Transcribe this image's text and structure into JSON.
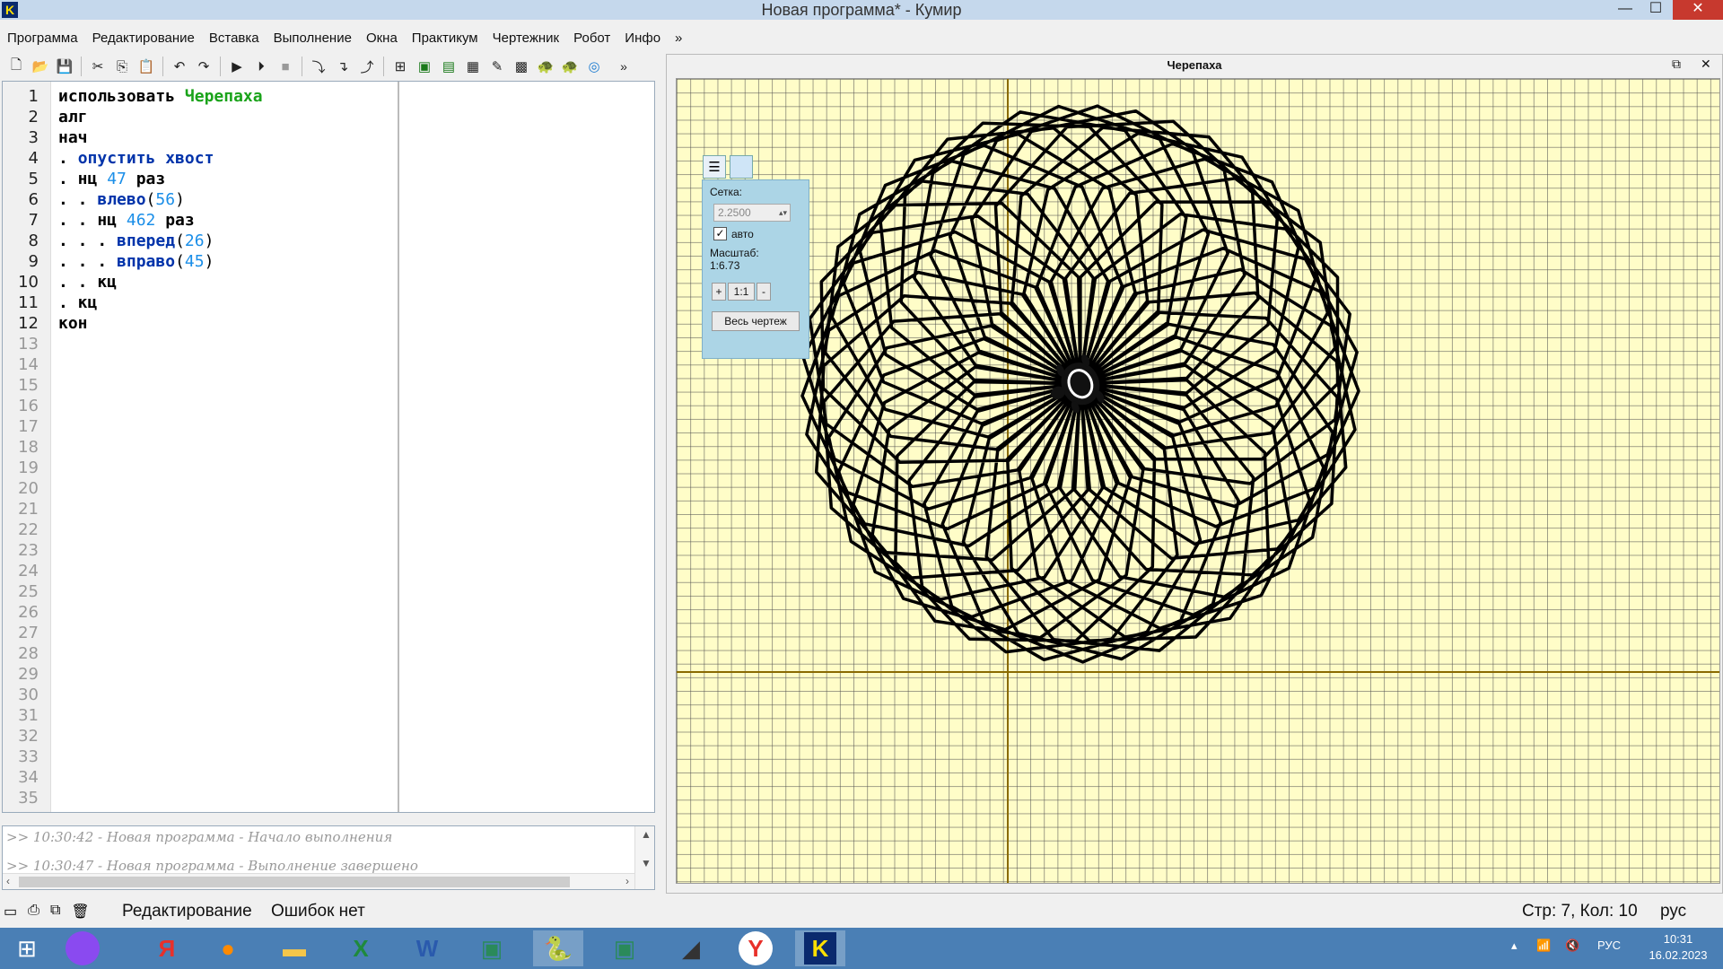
{
  "window": {
    "title": "Новая программа* - Кумир",
    "logo": "K",
    "min": "—",
    "max": "☐",
    "close": "✕"
  },
  "menu": [
    "Программа",
    "Редактирование",
    "Вставка",
    "Выполнение",
    "Окна",
    "Практикум",
    "Чертежник",
    "Робот",
    "Инфо",
    "»"
  ],
  "toolbar": {
    "icons": [
      "new-file",
      "open-folder",
      "save",
      "cut",
      "copy",
      "paste",
      "undo",
      "redo",
      "run",
      "step",
      "stop",
      "step-into",
      "step-over",
      "step-out",
      "variables",
      "robot-panel",
      "drawer-panel",
      "grid",
      "painter",
      "turtle",
      "turtle-alt",
      "water"
    ],
    "more": "»"
  },
  "editor": {
    "lines": [
      [
        {
          "t": "использовать ",
          "c": "kw"
        },
        {
          "t": "Черепаха",
          "c": "grn"
        }
      ],
      [
        {
          "t": "алг",
          "c": "kw"
        }
      ],
      [
        {
          "t": "нач",
          "c": "kw"
        }
      ],
      [
        {
          "t": ". ",
          "c": "kw"
        },
        {
          "t": "опустить хвост",
          "c": "kwb"
        }
      ],
      [
        {
          "t": ". нц ",
          "c": "kw"
        },
        {
          "t": "47",
          "c": "num"
        },
        {
          "t": " раз",
          "c": "kw"
        }
      ],
      [
        {
          "t": ". . ",
          "c": "kw"
        },
        {
          "t": "влево",
          "c": "kwb"
        },
        {
          "t": "(",
          "c": ""
        },
        {
          "t": "56",
          "c": "num"
        },
        {
          "t": ")",
          "c": ""
        }
      ],
      [
        {
          "t": ". . нц ",
          "c": "kw"
        },
        {
          "t": "462",
          "c": "num"
        },
        {
          "t": " раз",
          "c": "kw"
        }
      ],
      [
        {
          "t": ". . . ",
          "c": "kw"
        },
        {
          "t": "вперед",
          "c": "kwb"
        },
        {
          "t": "(",
          "c": ""
        },
        {
          "t": "26",
          "c": "num"
        },
        {
          "t": ")",
          "c": ""
        }
      ],
      [
        {
          "t": ". . . ",
          "c": "kw"
        },
        {
          "t": "вправо",
          "c": "kwb"
        },
        {
          "t": "(",
          "c": ""
        },
        {
          "t": "45",
          "c": "num"
        },
        {
          "t": ")",
          "c": ""
        }
      ],
      [
        {
          "t": ". . кц",
          "c": "kw"
        }
      ],
      [
        {
          "t": ". кц",
          "c": "kw"
        }
      ],
      [
        {
          "t": "кон",
          "c": "kw"
        }
      ]
    ],
    "line_count": 35
  },
  "output": {
    "lines": [
      ">> 10:30:42 - Новая программа - Начало выполнения",
      ">> 10:30:47 - Новая программа - Выполнение завершено"
    ]
  },
  "status": {
    "mode": "Редактирование",
    "errors": "Ошибок нет",
    "position": "Стр: 7, Кол: 10",
    "lang": "рус"
  },
  "turtle": {
    "title": "Черепаха",
    "panel": {
      "grid_label": "Сетка:",
      "grid_value": "2.2500",
      "auto_label": "авто",
      "auto_checked": true,
      "scale_label": "Масштаб:",
      "scale_value": "1:6.73",
      "zoom_in": "+",
      "zoom_reset": "1:1",
      "zoom_out": "-",
      "whole_drawing": "Весь чертеж"
    },
    "program": {
      "outer_repeat": 47,
      "left_angle": 56,
      "inner_repeat": 462,
      "forward": 26,
      "right_angle": 45
    }
  },
  "taskbar": {
    "apps": [
      "windows",
      "alice",
      "yandex-browser",
      "firefox",
      "file-explorer",
      "excel",
      "word",
      "app-green",
      "python",
      "app-green-2",
      "scanner",
      "yandex",
      "kumir"
    ],
    "tray_lang": "РУС",
    "time": "10:31",
    "date": "16.02.2023"
  }
}
